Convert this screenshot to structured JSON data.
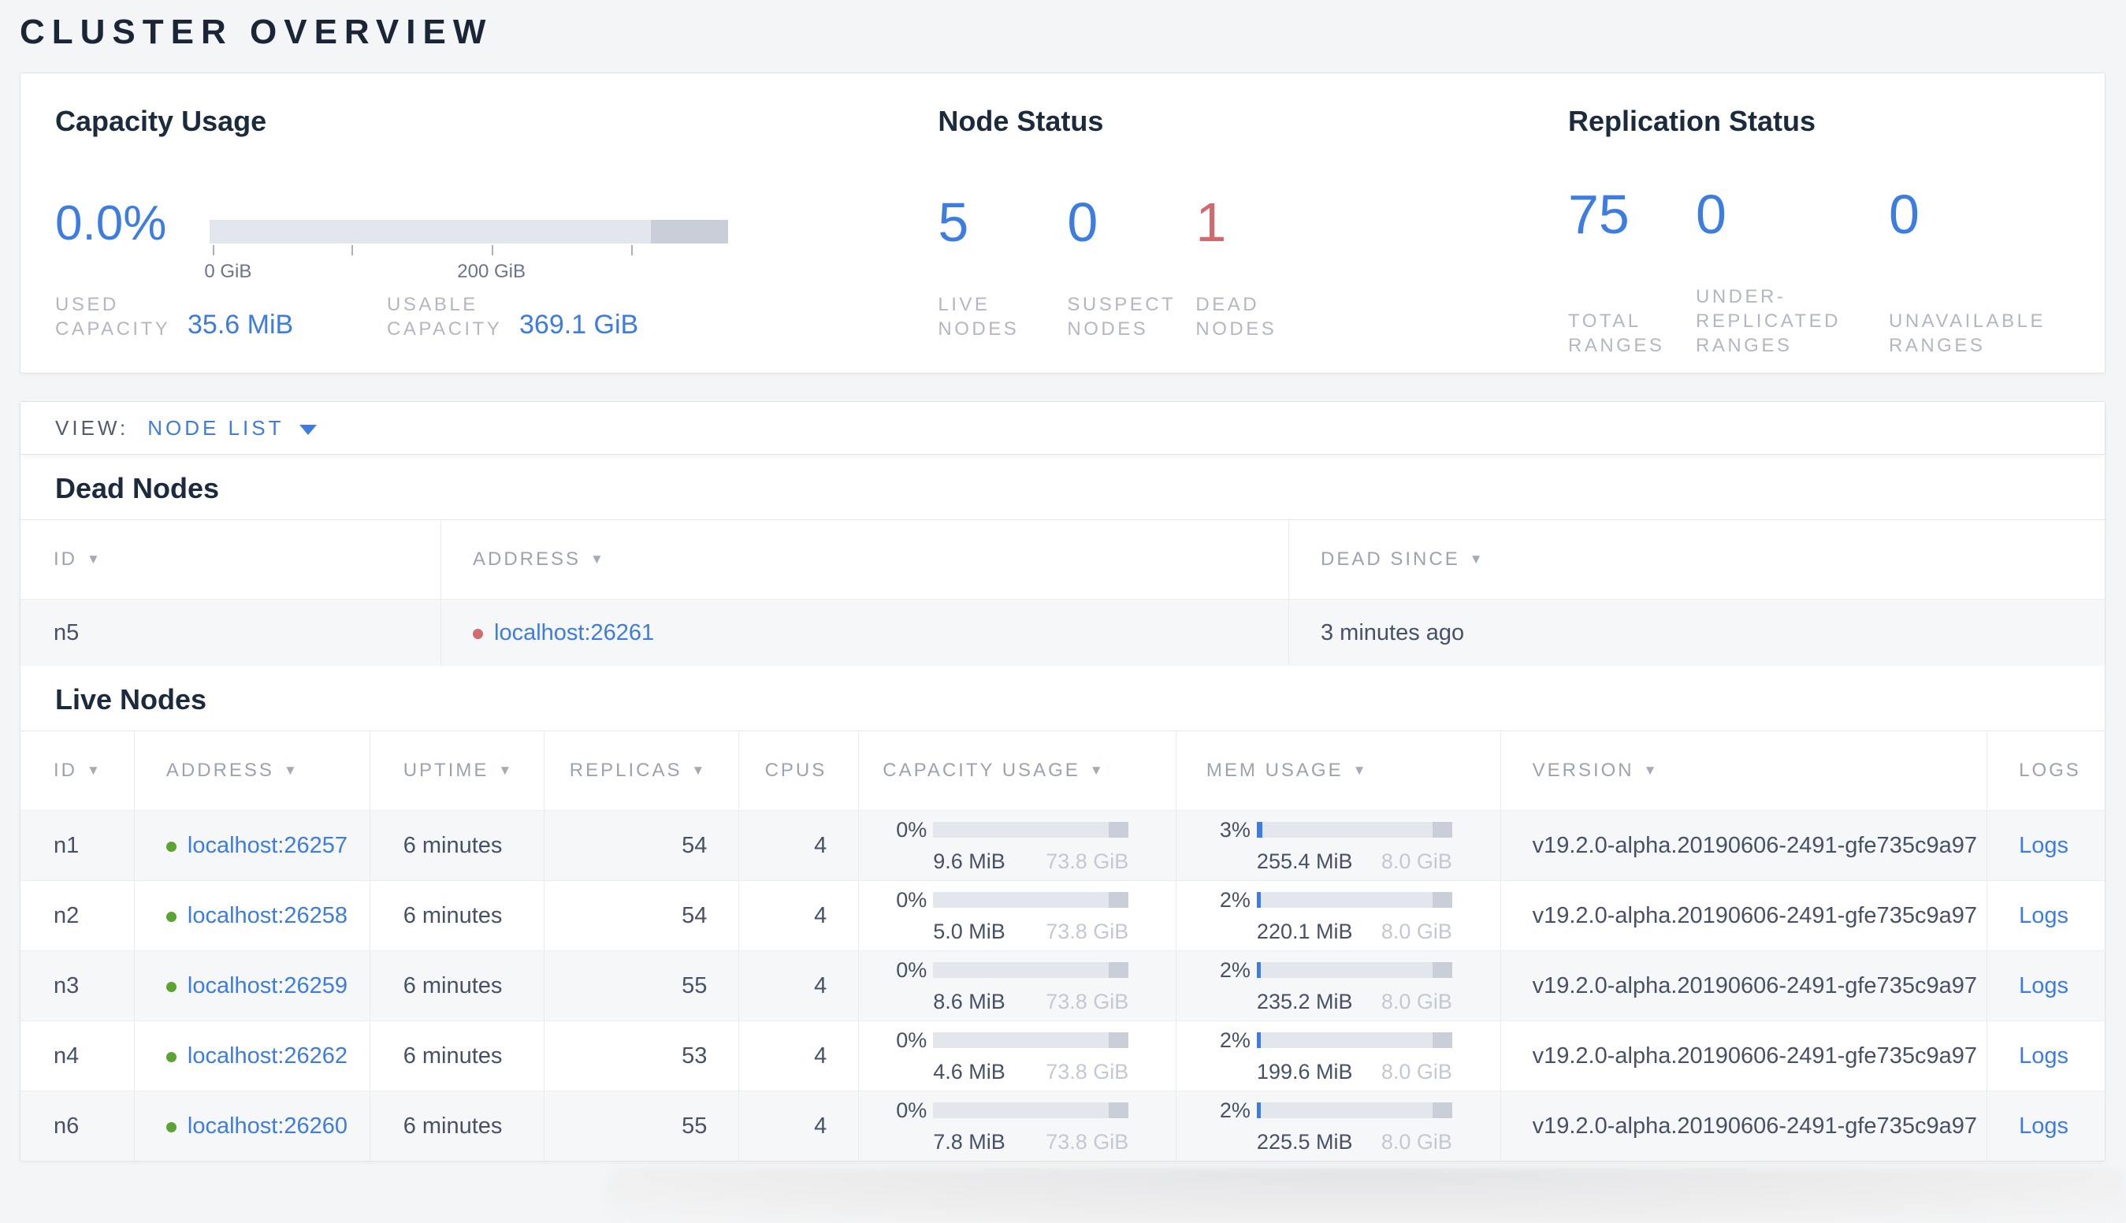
{
  "page": {
    "title": "CLUSTER OVERVIEW"
  },
  "icons": {
    "sort_arrow": "▼"
  },
  "colors": {
    "accent_blue": "#3d7ce0",
    "danger_red": "#d2696f",
    "live_dot_green": "#5ba332",
    "dead_dot_red": "#d26d6d"
  },
  "summary": {
    "capacity": {
      "title": "Capacity Usage",
      "percent": "0.0%",
      "axis": {
        "tick1_label": "0 GiB",
        "tick3_label": "200 GiB"
      },
      "used_label": "USED CAPACITY",
      "used_value": "35.6 MiB",
      "usable_label": "USABLE CAPACITY",
      "usable_value": "369.1 GiB"
    },
    "node_status": {
      "title": "Node Status",
      "live": {
        "value": "5",
        "label": "LIVE NODES"
      },
      "suspect": {
        "value": "0",
        "label": "SUSPECT NODES"
      },
      "dead": {
        "value": "1",
        "label": "DEAD NODES"
      }
    },
    "replication": {
      "title": "Replication Status",
      "total": {
        "value": "75",
        "label": "TOTAL RANGES"
      },
      "under": {
        "value": "0",
        "label": "UNDER-REPLICATED RANGES"
      },
      "unavailable": {
        "value": "0",
        "label": "UNAVAILABLE RANGES"
      }
    }
  },
  "view_bar": {
    "label": "VIEW:",
    "selected": "NODE LIST"
  },
  "dead_nodes": {
    "title": "Dead Nodes",
    "columns": {
      "id": "ID",
      "address": "ADDRESS",
      "dead_since": "DEAD SINCE"
    },
    "rows": [
      {
        "id": "n5",
        "address": "localhost:26261",
        "dead_since": "3 minutes ago"
      }
    ]
  },
  "live_nodes": {
    "title": "Live Nodes",
    "columns": {
      "id": "ID",
      "address": "ADDRESS",
      "uptime": "UPTIME",
      "replicas": "REPLICAS",
      "cpus": "CPUS",
      "capacity": "CAPACITY USAGE",
      "mem": "MEM USAGE",
      "version": "VERSION",
      "logs": "LOGS"
    },
    "rows": [
      {
        "id": "n1",
        "address": "localhost:26257",
        "uptime": "6 minutes",
        "replicas": "54",
        "cpus": "4",
        "cap_pct": "0%",
        "cap_fill": "0%",
        "cap_used": "9.6 MiB",
        "cap_total": "73.8 GiB",
        "mem_pct": "3%",
        "mem_fill": "3%",
        "mem_used": "255.4 MiB",
        "mem_total": "8.0 GiB",
        "version": "v19.2.0-alpha.20190606-2491-gfe735c9a97",
        "logs": "Logs"
      },
      {
        "id": "n2",
        "address": "localhost:26258",
        "uptime": "6 minutes",
        "replicas": "54",
        "cpus": "4",
        "cap_pct": "0%",
        "cap_fill": "0%",
        "cap_used": "5.0 MiB",
        "cap_total": "73.8 GiB",
        "mem_pct": "2%",
        "mem_fill": "2%",
        "mem_used": "220.1 MiB",
        "mem_total": "8.0 GiB",
        "version": "v19.2.0-alpha.20190606-2491-gfe735c9a97",
        "logs": "Logs"
      },
      {
        "id": "n3",
        "address": "localhost:26259",
        "uptime": "6 minutes",
        "replicas": "55",
        "cpus": "4",
        "cap_pct": "0%",
        "cap_fill": "0%",
        "cap_used": "8.6 MiB",
        "cap_total": "73.8 GiB",
        "mem_pct": "2%",
        "mem_fill": "2%",
        "mem_used": "235.2 MiB",
        "mem_total": "8.0 GiB",
        "version": "v19.2.0-alpha.20190606-2491-gfe735c9a97",
        "logs": "Logs"
      },
      {
        "id": "n4",
        "address": "localhost:26262",
        "uptime": "6 minutes",
        "replicas": "53",
        "cpus": "4",
        "cap_pct": "0%",
        "cap_fill": "0%",
        "cap_used": "4.6 MiB",
        "cap_total": "73.8 GiB",
        "mem_pct": "2%",
        "mem_fill": "2%",
        "mem_used": "199.6 MiB",
        "mem_total": "8.0 GiB",
        "version": "v19.2.0-alpha.20190606-2491-gfe735c9a97",
        "logs": "Logs"
      },
      {
        "id": "n6",
        "address": "localhost:26260",
        "uptime": "6 minutes",
        "replicas": "55",
        "cpus": "4",
        "cap_pct": "0%",
        "cap_fill": "0%",
        "cap_used": "7.8 MiB",
        "cap_total": "73.8 GiB",
        "mem_pct": "2%",
        "mem_fill": "2%",
        "mem_used": "225.5 MiB",
        "mem_total": "8.0 GiB",
        "version": "v19.2.0-alpha.20190606-2491-gfe735c9a97",
        "logs": "Logs"
      }
    ]
  }
}
